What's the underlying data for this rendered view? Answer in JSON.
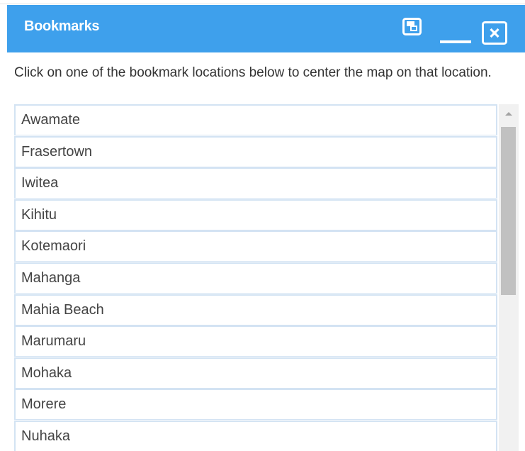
{
  "window": {
    "title": "Bookmarks",
    "maximize_icon": "maximize-icon",
    "minimize_icon": "minimize-icon",
    "close_icon": "close-icon"
  },
  "instructions": "Click on one of the bookmark locations below to center the map on that location.",
  "bookmarks": [
    "Awamate",
    "Frasertown",
    "Iwitea",
    "Kihitu",
    "Kotemaori",
    "Mahanga",
    "Mahia Beach",
    "Marumaru",
    "Mohaka",
    "Morere",
    "Nuhaka"
  ],
  "colors": {
    "titlebar": "#3ea0ec",
    "item_border": "#d3e3f3",
    "text": "#444444"
  }
}
